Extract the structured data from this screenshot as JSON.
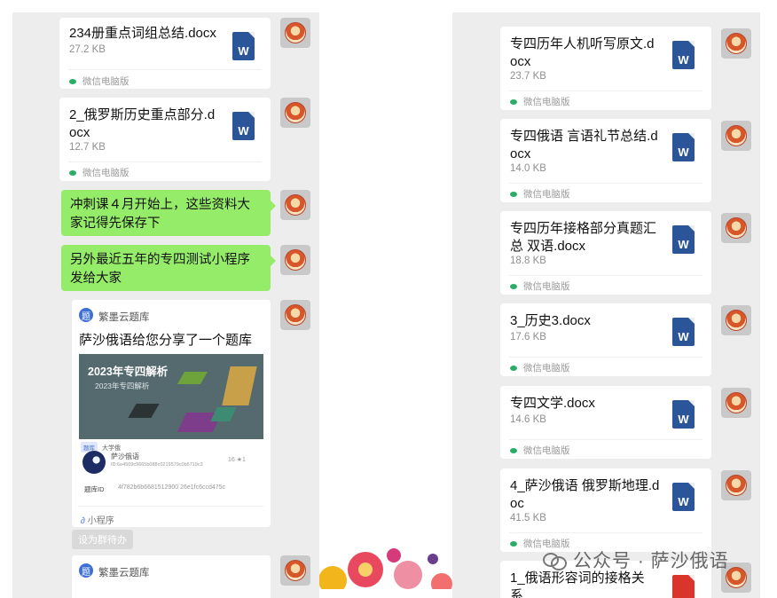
{
  "left_chat": {
    "files": [
      {
        "name": "234册重点词组总结.docx",
        "size": "27.2 KB",
        "source": "微信电脑版"
      },
      {
        "name": "2_俄罗斯历史重点部分.docx",
        "size": "12.7 KB",
        "source": "微信电脑版"
      }
    ],
    "messages": [
      "冲刺课４月开始上，这些资料大家记得先保存下",
      "另外最近五年的专四测试小程序发给大家"
    ],
    "mini_program": {
      "brand": "繁墨云题库",
      "title": "萨沙俄语给您分享了一个题库",
      "thumb_title": "2023年专四解析",
      "thumb_subtitle": "2023年专四解析",
      "tags": [
        "题库",
        "大学俄"
      ],
      "author": "萨沙俄语",
      "author_id": "ID:6e4509c9665b088c0219579c0b5719c3",
      "stats": "16 ★1",
      "bank_id_label": "题库ID",
      "bank_id": "4f782b6b6681512900 26e1fc6ccd475c",
      "footer": "小程序"
    },
    "set_button": "设为群待办",
    "mini_program_2": {
      "brand": "繁墨云题库"
    }
  },
  "right_chat": {
    "files": [
      {
        "name": "专四历年人机听写原文.docx",
        "size": "23.7 KB",
        "source": "微信电脑版"
      },
      {
        "name": "专四俄语 言语礼节总结.docx",
        "size": "14.0 KB",
        "source": "微信电脑版"
      },
      {
        "name": "专四历年接格部分真题汇总 双语.docx",
        "size": "18.8 KB",
        "source": "微信电脑版"
      },
      {
        "name": "3_历史3.docx",
        "size": "17.6 KB",
        "source": "微信电脑版"
      },
      {
        "name": "专四文学.docx",
        "size": "14.6 KB",
        "source": "微信电脑版"
      },
      {
        "name": "4_萨沙俄语 俄罗斯地理.doc",
        "size": "41.5 KB",
        "source": "微信电脑版"
      },
      {
        "name": "1_俄语形容词的接格关系."
      }
    ]
  },
  "icons": {
    "file": "W"
  },
  "watermark": "公众号 · 萨沙俄语",
  "colors": {
    "bubble_green": "#95ec69",
    "word_blue": "#2a5599",
    "chat_bg": "#ededed"
  }
}
